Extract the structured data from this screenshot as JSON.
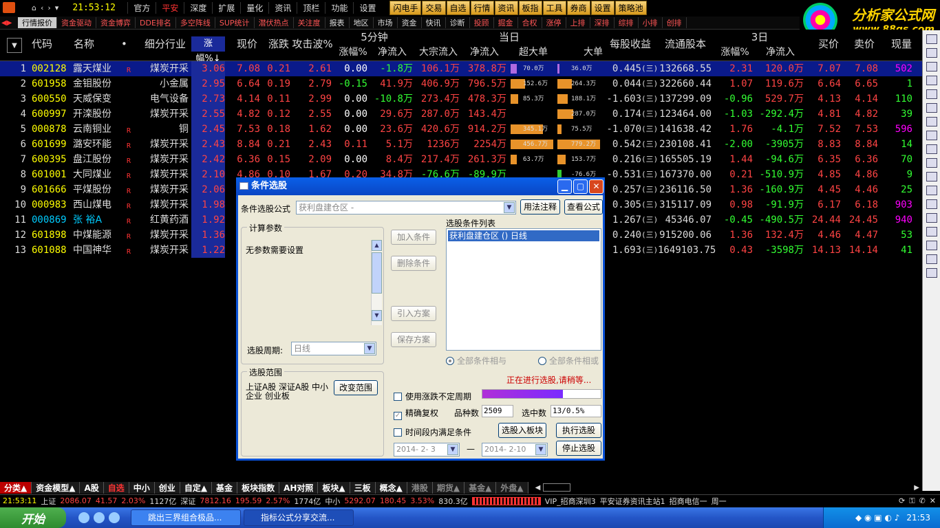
{
  "menubar": {
    "time": "21:53:12",
    "items": [
      "官方",
      "平安",
      "深度",
      "扩展",
      "量化",
      "资讯",
      "顶栏",
      "功能",
      "设置"
    ],
    "toolbtns": [
      "闪电手",
      "交易",
      "自选",
      "行情",
      "资讯",
      "板指",
      "工具",
      "券商",
      "设置",
      "策略池"
    ]
  },
  "brand": {
    "line1": "分析家公式网",
    "line2": "www.88gs.com"
  },
  "tabs": [
    "行情报价",
    "资金驱动",
    "资金博弈",
    "DDE排名",
    "多空阵线",
    "SUP统计",
    "潜伏热点",
    "关注度",
    "报表",
    "地区",
    "市场",
    "资金",
    "快讯",
    "诊断",
    "投顾",
    "掘金",
    "合权",
    "涨停",
    "上排",
    "深排",
    "综排",
    "小排",
    "创排"
  ],
  "header": {
    "code": "代码",
    "name": "名称",
    "industry": "细分行业",
    "pct": "涨幅%↓",
    "price": "现价",
    "change": "涨跌",
    "attack": "攻击波%",
    "g5": "5分钟",
    "g5pct": "涨幅%",
    "g5flow": "净流入",
    "gday": "当日",
    "bulk": "大宗流入",
    "dflow": "净流入",
    "superbig": "超大单",
    "big": "大单",
    "eps": "每股收益",
    "float": "流通股本",
    "g3": "3日",
    "g3pct": "涨幅%",
    "g3flow": "净流入",
    "buy": "买价",
    "sell": "卖价",
    "vol": "现量"
  },
  "rows": [
    {
      "n": "1",
      "code": "002128",
      "name": "露天煤业",
      "r": "R",
      "ind": "煤炭开采",
      "pct": "3.06",
      "price": "7.08",
      "chg": "0.21",
      "atk": "2.61",
      "p5": "0.00",
      "f5": "-1.8万",
      "bulk": "106.1万",
      "dflow": "378.8万",
      "sb": "70.0万",
      "b": "36.0万",
      "eps": "0.445",
      "float": "132668.55",
      "p3": "2.31",
      "f3": "120.0万",
      "buy": "7.07",
      "sell": "7.08",
      "vol": "502"
    },
    {
      "n": "2",
      "code": "601958",
      "name": "金钼股份",
      "r": "",
      "ind": "小金属",
      "pct": "2.95",
      "price": "6.64",
      "chg": "0.19",
      "atk": "2.79",
      "p5": "-0.15",
      "f5": "41.9万",
      "bulk": "406.9万",
      "dflow": "796.5万",
      "sb": "152.6万",
      "b": "264.3万",
      "eps": "0.044",
      "float": "322660.44",
      "p3": "1.07",
      "f3": "119.6万",
      "buy": "6.64",
      "sell": "6.65",
      "vol": "1"
    },
    {
      "n": "3",
      "code": "600550",
      "name": "天威保变",
      "r": "",
      "ind": "电气设备",
      "pct": "2.73",
      "price": "4.14",
      "chg": "0.11",
      "atk": "2.99",
      "p5": "0.00",
      "f5": "-10.8万",
      "bulk": "273.4万",
      "dflow": "478.3万",
      "sb": "85.3万",
      "b": "188.1万",
      "eps": "-1.603",
      "float": "137299.09",
      "p3": "-0.96",
      "f3": "529.7万",
      "buy": "4.13",
      "sell": "4.14",
      "vol": "110"
    },
    {
      "n": "4",
      "code": "600997",
      "name": "开滦股份",
      "r": "",
      "ind": "煤炭开采",
      "pct": "2.55",
      "price": "4.82",
      "chg": "0.12",
      "atk": "2.55",
      "p5": "0.00",
      "f5": "29.6万",
      "bulk": "287.0万",
      "dflow": "143.4万",
      "sb": "",
      "b": "287.0万",
      "eps": "0.174",
      "float": "123464.00",
      "p3": "-1.03",
      "f3": "-292.4万",
      "buy": "4.81",
      "sell": "4.82",
      "vol": "39"
    },
    {
      "n": "5",
      "code": "000878",
      "name": "云南铜业",
      "r": "R",
      "ind": "铜",
      "pct": "2.45",
      "price": "7.53",
      "chg": "0.18",
      "atk": "1.62",
      "p5": "0.00",
      "f5": "23.6万",
      "bulk": "420.6万",
      "dflow": "914.2万",
      "sb": "345.1万",
      "b": "75.5万",
      "eps": "-1.070",
      "float": "141638.42",
      "p3": "1.76",
      "f3": "-4.1万",
      "buy": "7.52",
      "sell": "7.53",
      "vol": "596"
    },
    {
      "n": "6",
      "code": "601699",
      "name": "潞安环能",
      "r": "R",
      "ind": "煤炭开采",
      "pct": "2.43",
      "price": "8.84",
      "chg": "0.21",
      "atk": "2.43",
      "p5": "0.11",
      "f5": "5.1万",
      "bulk": "1236万",
      "dflow": "2254万",
      "sb": "456.7万",
      "b": "779.2万",
      "eps": "0.542",
      "float": "230108.41",
      "p3": "-2.00",
      "f3": "-3905万",
      "buy": "8.83",
      "sell": "8.84",
      "vol": "14"
    },
    {
      "n": "7",
      "code": "600395",
      "name": "盘江股份",
      "r": "R",
      "ind": "煤炭开采",
      "pct": "2.42",
      "price": "6.36",
      "chg": "0.15",
      "atk": "2.09",
      "p5": "0.00",
      "f5": "8.4万",
      "bulk": "217.4万",
      "dflow": "261.3万",
      "sb": "63.7万",
      "b": "153.7万",
      "eps": "0.216",
      "float": "165505.19",
      "p3": "1.44",
      "f3": "-94.6万",
      "buy": "6.35",
      "sell": "6.36",
      "vol": "70"
    },
    {
      "n": "8",
      "code": "601001",
      "name": "大同煤业",
      "r": "R",
      "ind": "煤炭开采",
      "pct": "2.10",
      "price": "4.86",
      "chg": "0.10",
      "atk": "1.67",
      "p5": "0.20",
      "f5": "34.8万",
      "bulk": "-76.6万",
      "dflow": "-89.9万",
      "sb": "",
      "b": "-76.6万",
      "eps": "-0.531",
      "float": "167370.00",
      "p3": "0.21",
      "f3": "-510.9万",
      "buy": "4.85",
      "sell": "4.86",
      "vol": "9"
    },
    {
      "n": "9",
      "code": "601666",
      "name": "平煤股份",
      "r": "R",
      "ind": "煤炭开采",
      "pct": "2.06",
      "price": "",
      "chg": "",
      "atk": "",
      "p5": "",
      "f5": "",
      "bulk": "",
      "dflow": "",
      "sb": "",
      "b": "",
      "eps": "0.257",
      "float": "236116.50",
      "p3": "1.36",
      "f3": "-160.9万",
      "buy": "4.45",
      "sell": "4.46",
      "vol": "25"
    },
    {
      "n": "10",
      "code": "000983",
      "name": "西山煤电",
      "r": "R",
      "ind": "煤炭开采",
      "pct": "1.98",
      "price": "",
      "chg": "",
      "atk": "",
      "p5": "",
      "f5": "",
      "bulk": "",
      "dflow": "",
      "sb": "",
      "b": "",
      "eps": "0.305",
      "float": "315117.09",
      "p3": "0.98",
      "f3": "-91.9万",
      "buy": "6.17",
      "sell": "6.18",
      "vol": "903"
    },
    {
      "n": "11",
      "code": "000869",
      "name": "张 裕A",
      "r": "R",
      "ind": "红黄药酒",
      "pct": "1.92",
      "price": "",
      "chg": "",
      "atk": "",
      "p5": "",
      "f5": "",
      "bulk": "",
      "dflow": "",
      "sb": "",
      "b": "",
      "eps": "1.267",
      "float": "45346.07",
      "p3": "-0.45",
      "f3": "-490.5万",
      "buy": "24.44",
      "sell": "24.45",
      "vol": "940"
    },
    {
      "n": "12",
      "code": "601898",
      "name": "中煤能源",
      "r": "R",
      "ind": "煤炭开采",
      "pct": "1.36",
      "price": "",
      "chg": "",
      "atk": "",
      "p5": "",
      "f5": "",
      "bulk": "",
      "dflow": "",
      "sb": "",
      "b": "",
      "eps": "0.240",
      "float": "915200.06",
      "p3": "1.36",
      "f3": "132.4万",
      "buy": "4.46",
      "sell": "4.47",
      "vol": "53"
    },
    {
      "n": "13",
      "code": "601088",
      "name": "中国神华",
      "r": "R",
      "ind": "煤炭开采",
      "pct": "1.22",
      "price": "",
      "chg": "",
      "atk": "",
      "p5": "",
      "f5": "",
      "bulk": "",
      "dflow": "",
      "sb": "",
      "b": "",
      "eps": "1.693",
      "float": "1649103.75",
      "p3": "0.43",
      "f3": "-3598万",
      "buy": "14.13",
      "sell": "14.14",
      "vol": "41"
    }
  ],
  "eps_suffix": "(三)",
  "dialog": {
    "title": "条件选股",
    "formula_label": "条件选股公式",
    "formula_value": "获利盘建仓区 -",
    "btn_usage": "用法注释",
    "btn_view": "查看公式",
    "params_label": "计算参数",
    "params_text": "无参数需要设置",
    "period_label": "选股周期:",
    "period_value": "日线",
    "btn_add": "加入条件",
    "btn_delete": "删除条件",
    "btn_import": "引入方案",
    "btn_save": "保存方案",
    "list_label": "选股条件列表",
    "list_item": "获利盘建仓区 () 日线",
    "radio_and": "全部条件相与",
    "radio_or": "全部条件相或",
    "range_label": "选股范围",
    "range_text": "上证A股 深证A股 中小企业 创业板",
    "btn_range": "改变范围",
    "status": "正在进行选股,请稍等...",
    "chk_uncertain": "使用涨跌不定周期",
    "chk_exact": "精确复权",
    "count_label": "品种数",
    "count_value": "2509",
    "hit_label": "选中数",
    "hit_value": "13/0.5%",
    "chk_time": "时间段内满足条件",
    "btn_to_block": "选股入板块",
    "btn_run": "执行选股",
    "date_from": "2014- 2- 3",
    "date_sep": "—",
    "date_to": "2014- 2-10",
    "btn_stop": "停止选股",
    "progress": 0.68
  },
  "bottomtabs": [
    "分类▲",
    "资金模型▲",
    "A股",
    "自选",
    "中小",
    "创业",
    "自定▲",
    "基金",
    "板块指数",
    "AH对照",
    "板块▲",
    "三板",
    "概念▲",
    "港股",
    "期货▲",
    "基金▲",
    "外盘▲"
  ],
  "status": {
    "time": "21:53:11",
    "sh_label": "上证",
    "sh_val": "2086.07",
    "sh_chg": "41.57",
    "sh_pct": "2.03%",
    "sh_amt": "1127亿",
    "sz_label": "深证",
    "sz_val": "7812.16",
    "sz_chg": "195.59",
    "sz_pct": "2.57%",
    "sz_amt": "1774亿",
    "zx_label": "中小",
    "zx_val": "5292.07",
    "zx_chg": "180.45",
    "zx_pct": "3.53%",
    "zx_amt": "830.3亿",
    "vip": "VIP_招商深圳3",
    "broker": "平安证券资讯主站1",
    "tel": "招商电信一",
    "week": "周一"
  },
  "taskbar": {
    "start": "开始",
    "task1": "跳出三界组合极品...",
    "task2": "指标公式分享交流...",
    "clock": "21:53"
  }
}
